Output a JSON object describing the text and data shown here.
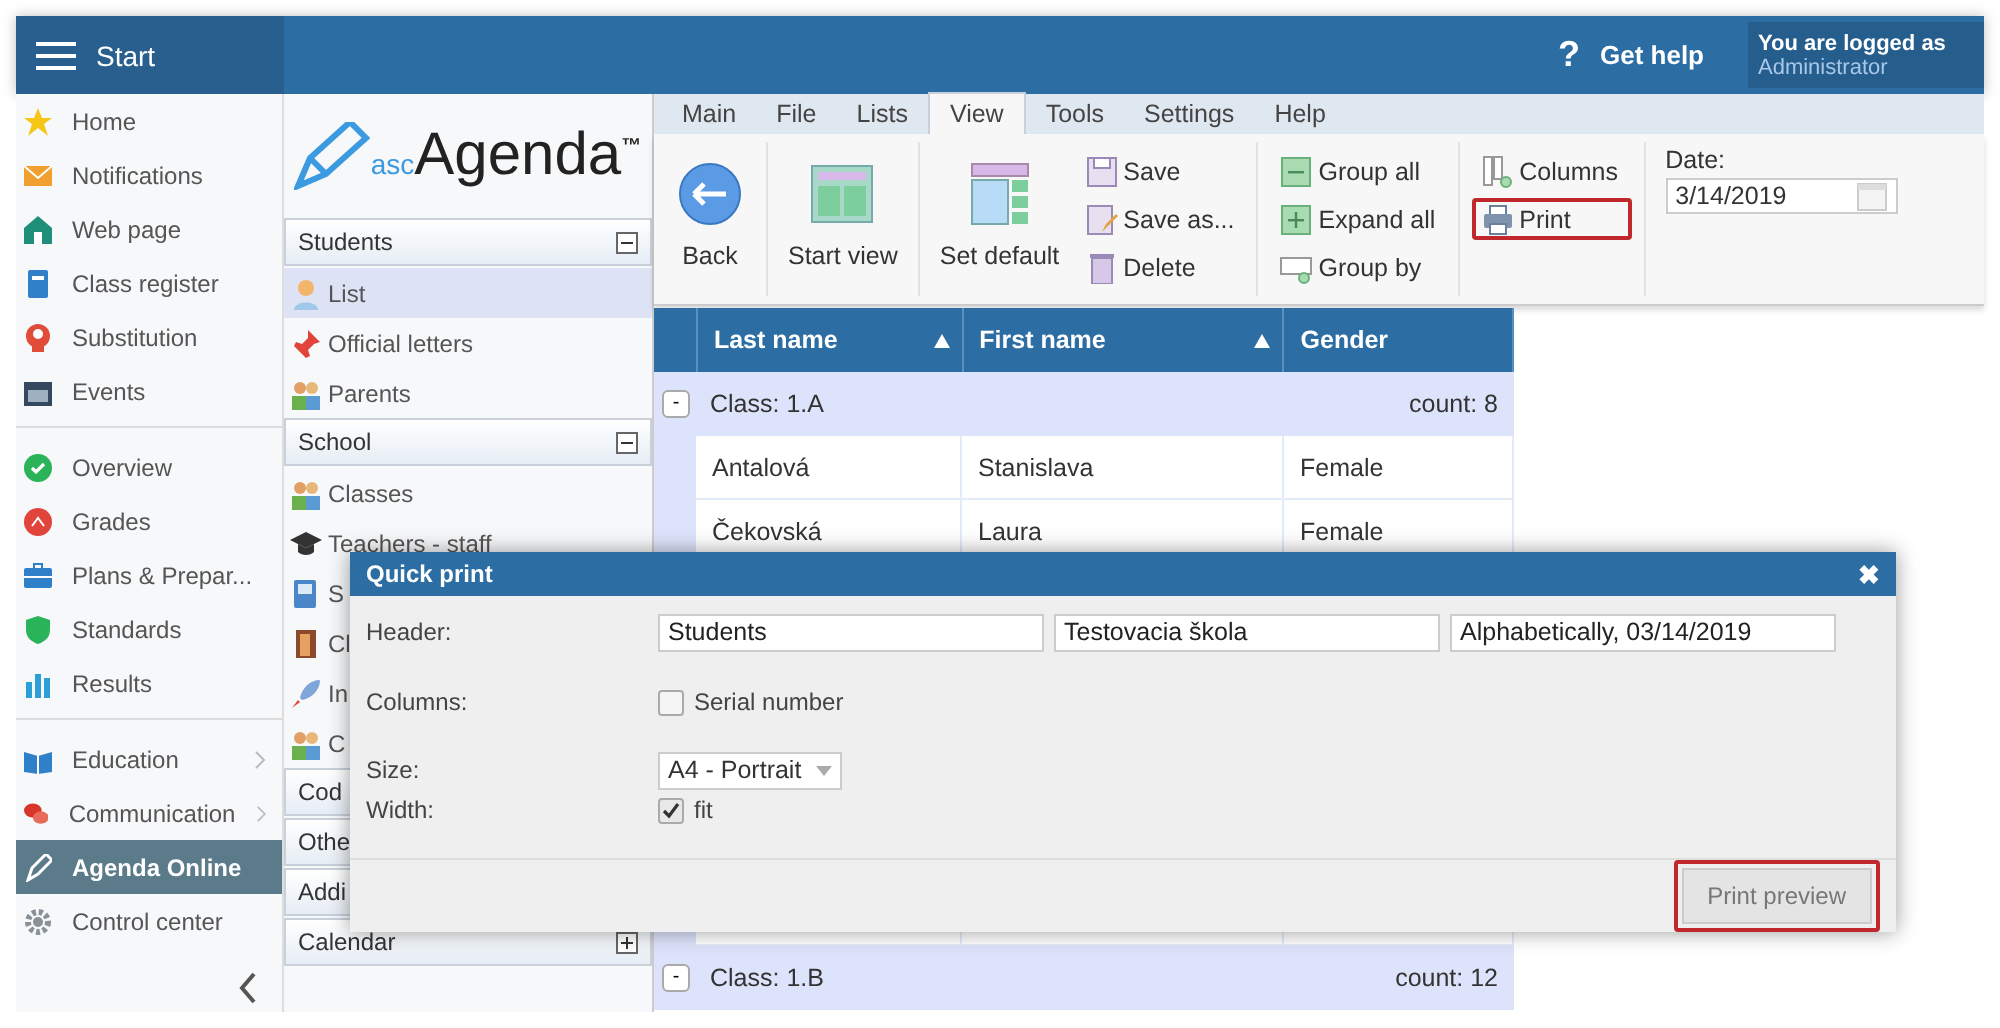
{
  "top_bar": {
    "title": "Start",
    "help_icon": "?",
    "help": "Get help",
    "user_caption": "You are logged as",
    "user_name": "Administrator"
  },
  "sidebar": {
    "groups": [
      {
        "items": [
          {
            "label": "Home",
            "selected": false,
            "submenu": false
          },
          {
            "label": "Notifications",
            "selected": false,
            "submenu": false
          },
          {
            "label": "Web page",
            "selected": false,
            "submenu": false
          },
          {
            "label": "Class register",
            "selected": false,
            "submenu": false
          },
          {
            "label": "Substitution",
            "selected": false,
            "submenu": false
          },
          {
            "label": "Events",
            "selected": false,
            "submenu": false
          }
        ]
      },
      {
        "items": [
          {
            "label": "Overview",
            "selected": false,
            "submenu": false
          },
          {
            "label": "Grades",
            "selected": false,
            "submenu": false
          },
          {
            "label": "Plans & Prepar...",
            "selected": false,
            "submenu": false
          },
          {
            "label": "Standards",
            "selected": false,
            "submenu": false
          },
          {
            "label": "Results",
            "selected": false,
            "submenu": false
          }
        ]
      },
      {
        "items": [
          {
            "label": "Education",
            "selected": false,
            "submenu": true
          },
          {
            "label": "Communication",
            "selected": false,
            "submenu": true
          },
          {
            "label": "Agenda Online",
            "selected": true,
            "submenu": false
          },
          {
            "label": "Control center",
            "selected": false,
            "submenu": false
          }
        ]
      }
    ]
  },
  "logo": {
    "prefix": "asc",
    "name": "Agenda",
    "mark": "™"
  },
  "sections": [
    {
      "title": "Students",
      "expanded": true,
      "items": [
        {
          "label": "List",
          "selected": true
        },
        {
          "label": "Official letters",
          "selected": false
        },
        {
          "label": "Parents",
          "selected": false
        }
      ]
    },
    {
      "title": "School",
      "expanded": true,
      "items": [
        {
          "label": "Classes",
          "selected": false
        },
        {
          "label": "Teachers - staff",
          "selected": false
        },
        {
          "label": "S",
          "selected": false
        },
        {
          "label": "Cl",
          "selected": false
        },
        {
          "label": "In",
          "selected": false
        },
        {
          "label": "C",
          "selected": false
        }
      ]
    },
    {
      "title": "Cod"
    },
    {
      "title": "Othe"
    },
    {
      "title": "Addi"
    },
    {
      "title": "Calendar",
      "expanded": false
    }
  ],
  "ribbon": {
    "tabs": [
      {
        "label": "Main",
        "selected": false
      },
      {
        "label": "File",
        "selected": false
      },
      {
        "label": "Lists",
        "selected": false
      },
      {
        "label": "View",
        "selected": true
      },
      {
        "label": "Tools",
        "selected": false
      },
      {
        "label": "Settings",
        "selected": false
      },
      {
        "label": "Help",
        "selected": false
      }
    ],
    "groups": [
      {
        "items": [
          {
            "kind": "large",
            "label": "Back",
            "highlighted": false
          }
        ]
      },
      {
        "items": [
          {
            "kind": "large",
            "label": "Start view",
            "highlighted": false
          }
        ]
      },
      {
        "items": [
          {
            "kind": "large",
            "label": "Set default",
            "highlighted": false
          },
          {
            "kind": "small",
            "label": "Save",
            "highlighted": false
          },
          {
            "kind": "small",
            "label": "Save as...",
            "highlighted": false
          },
          {
            "kind": "small",
            "label": "Delete",
            "highlighted": false
          }
        ]
      },
      {
        "items": [
          {
            "kind": "small",
            "label": "Group all",
            "highlighted": false
          },
          {
            "kind": "small",
            "label": "Expand all",
            "highlighted": false
          },
          {
            "kind": "small",
            "label": "Group by",
            "highlighted": false
          }
        ]
      },
      {
        "items": [
          {
            "kind": "small",
            "label": "Columns",
            "highlighted": false
          },
          {
            "kind": "small",
            "label": "Print",
            "highlighted": true
          }
        ]
      }
    ],
    "date": {
      "label": "Date:",
      "value": "3/14/2019"
    }
  },
  "table": {
    "columns": [
      {
        "label": "Last name",
        "sorted": true
      },
      {
        "label": "First name",
        "sorted": true
      },
      {
        "label": "Gender",
        "sorted": false
      }
    ],
    "groups": [
      {
        "toggle": "-",
        "label": "Class: 1.A",
        "count": "count: 8",
        "rows": [
          [
            "Antalová",
            "Stanislava",
            "Female"
          ],
          [
            "Čekovská",
            "Laura",
            "Female"
          ]
        ]
      },
      {
        "toggle": "-",
        "label": "Class: 1.B",
        "count": "count: 12"
      }
    ]
  },
  "dialog": {
    "title": "Quick print",
    "close": "✖",
    "header_label": "Header:",
    "header_values": [
      "Students",
      "Testovacia škola",
      "Alphabetically, 03/14/2019"
    ],
    "columns_label": "Columns:",
    "columns_option": {
      "label": "Serial number",
      "checked": false
    },
    "size_label": "Size:",
    "size_value": "A4 - Portrait",
    "width_label": "Width:",
    "width_option": {
      "label": "fit",
      "checked": true
    },
    "button": {
      "label": "Print preview",
      "highlighted": true
    }
  }
}
